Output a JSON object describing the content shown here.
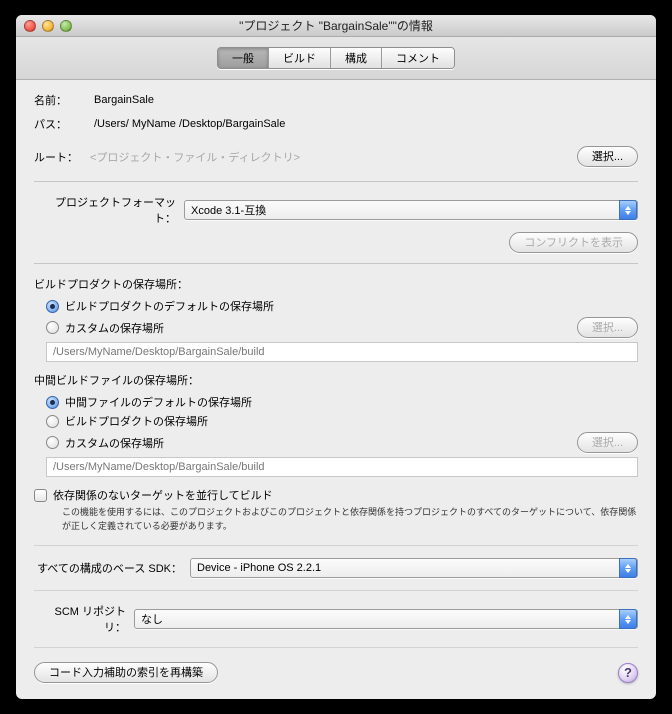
{
  "window": {
    "title": "\"プロジェクト \"BargainSale\"\"の情報"
  },
  "tabs": {
    "general": "一般",
    "build": "ビルド",
    "config": "構成",
    "comment": "コメント"
  },
  "labels": {
    "name": "名前：",
    "path": "パス：",
    "root": "ルート：",
    "root_ph": "<プロジェクト・ファイル・ディレクトリ>",
    "choose": "選択...",
    "project_format": "プロジェクトフォーマット：",
    "show_conflicts": "コンフリクトを表示",
    "build_loc_title": "ビルドプロダクトの保存場所：",
    "build_loc_default": "ビルドプロダクトのデフォルトの保存場所",
    "build_loc_custom": "カスタムの保存場所",
    "inter_loc_title": "中間ビルドファイルの保存場所：",
    "inter_loc_default": "中間ファイルのデフォルトの保存場所",
    "inter_loc_buildprod": "ビルドプロダクトの保存場所",
    "inter_loc_custom": "カスタムの保存場所",
    "dep_check": "依存関係のないターゲットを並行してビルド",
    "dep_note": "この機能を使用するには、このプロジェクトおよびこのプロジェクトと依存関係を持つプロジェクトのすべてのターゲットについて、依存関係が正しく定義されている必要があります。",
    "base_sdk": "すべての構成のベース SDK：",
    "scm": "SCM リポジトリ：",
    "rebuild_index": "コード入力補助の索引を再構築"
  },
  "values": {
    "name": "BargainSale",
    "path": "/Users/ MyName /Desktop/BargainSale",
    "format": "Xcode 3.1-互換",
    "build_path": "/Users/MyName/Desktop/BargainSale/build",
    "inter_path": "/Users/MyName/Desktop/BargainSale/build",
    "base_sdk": "Device - iPhone OS 2.2.1",
    "scm": "なし"
  }
}
